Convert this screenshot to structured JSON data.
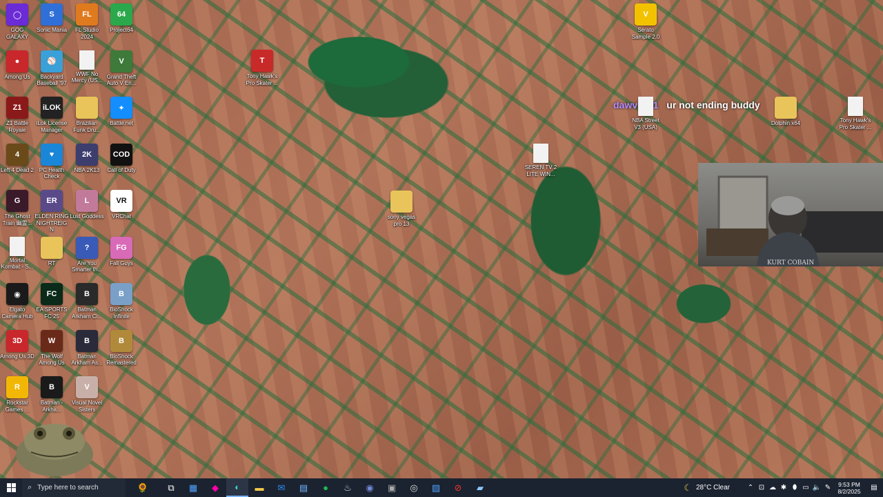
{
  "desktop_icons": [
    {
      "label": "GOG GALAXY",
      "color": "#6b2bd6",
      "glyph": "◯"
    },
    {
      "label": "Sonic Mania",
      "color": "#2f6fd8",
      "glyph": "S"
    },
    {
      "label": "FL Studio 2024",
      "color": "#e07a1f",
      "glyph": "FL"
    },
    {
      "label": "Project64",
      "color": "#2ca84c",
      "glyph": "64"
    },
    {
      "label": "Among Us",
      "color": "#c8272c",
      "glyph": "●"
    },
    {
      "label": "Backyard Baseball '97",
      "color": "#3aa0d8",
      "glyph": "⚾"
    },
    {
      "label": "WWF No Mercy (US...",
      "type": "file"
    },
    {
      "label": "Grand Theft Auto V En...",
      "color": "#3e7a3a",
      "glyph": "V"
    },
    {
      "label": "Z1 Battle Royale",
      "color": "#8a1a1a",
      "glyph": "Z1"
    },
    {
      "label": "iLok License Manager",
      "color": "#222",
      "glyph": "iLOK"
    },
    {
      "label": "Brazilian Funk Dru...",
      "type": "folder"
    },
    {
      "label": "Battle.net",
      "color": "#148eff",
      "glyph": "✦"
    },
    {
      "label": "Left 4 Dead 2",
      "color": "#6b4a1a",
      "glyph": "4"
    },
    {
      "label": "PC Health Check",
      "color": "#1a86d8",
      "glyph": "♥"
    },
    {
      "label": "NBA 2K13",
      "color": "#3d3d6e",
      "glyph": "2K"
    },
    {
      "label": "Call of Duty",
      "color": "#111",
      "glyph": "COD"
    },
    {
      "label": "The Ghost Train 幽霊...",
      "color": "#3b1a2a",
      "glyph": "G"
    },
    {
      "label": "ELDEN RING NIGHTREIGN",
      "color": "#5a4a8a",
      "glyph": "ER"
    },
    {
      "label": "Lust Goddess",
      "color": "#c27a9a",
      "glyph": "L"
    },
    {
      "label": "VRChat",
      "color": "#fff",
      "glyph": "VR"
    },
    {
      "label": "Mortal Kombat - S...",
      "type": "file"
    },
    {
      "label": "RT",
      "type": "folder"
    },
    {
      "label": "Are You Smarter th...",
      "color": "#3a5ab8",
      "glyph": "?"
    },
    {
      "label": "Fall Guys",
      "color": "#d86ab8",
      "glyph": "FG"
    },
    {
      "label": "Elgato Camera Hub",
      "color": "#1a1a1a",
      "glyph": "◉"
    },
    {
      "label": "EA SPORTS FC 25",
      "color": "#0a2a1a",
      "glyph": "FC"
    },
    {
      "label": "Batman Arkham Ci...",
      "color": "#2a2a2a",
      "glyph": "B"
    },
    {
      "label": "BioShock Infinite",
      "color": "#7aa0c8",
      "glyph": "B"
    },
    {
      "label": "Among Us 3D",
      "color": "#c8272c",
      "glyph": "3D"
    },
    {
      "label": "The Wolf Among Us",
      "color": "#6a2a1a",
      "glyph": "W"
    },
    {
      "label": "Batman Arkham As...",
      "color": "#2a2a3a",
      "glyph": "B"
    },
    {
      "label": "BioShock Remastered",
      "color": "#b08a3a",
      "glyph": "B"
    },
    {
      "label": "Rockstar Games ...",
      "color": "#f2b705",
      "glyph": "R"
    },
    {
      "label": "Batman - Arkha...",
      "color": "#1a1a1a",
      "glyph": "B"
    },
    {
      "label": "Visual Novel Sisters",
      "color": "#c8b0a8",
      "glyph": "V"
    }
  ],
  "scattered_icons": [
    {
      "label": "Serato Sample 2.0",
      "color": "#f2c200",
      "glyph": "V"
    },
    {
      "label": "Tony Hawk's Pro Skater ...",
      "color": "#c82a2a",
      "glyph": "T"
    },
    {
      "label": "NBA Street V3 (USA)",
      "type": "file"
    },
    {
      "label": "Dolphin x64",
      "type": "folder"
    },
    {
      "label": "Tony Hawk's Pro Skater ...",
      "type": "file"
    },
    {
      "label": "SEREN TV 2 LITE WIN...",
      "type": "file"
    },
    {
      "label": "sony vegas pro 13",
      "type": "folder"
    }
  ],
  "chat": {
    "user": "dawv7711",
    "message": "ur not ending buddy"
  },
  "taskbar": {
    "search_placeholder": "Type here to search",
    "weather": "28°C  Clear",
    "time": "9:53 PM",
    "date": "8/2/2025"
  }
}
